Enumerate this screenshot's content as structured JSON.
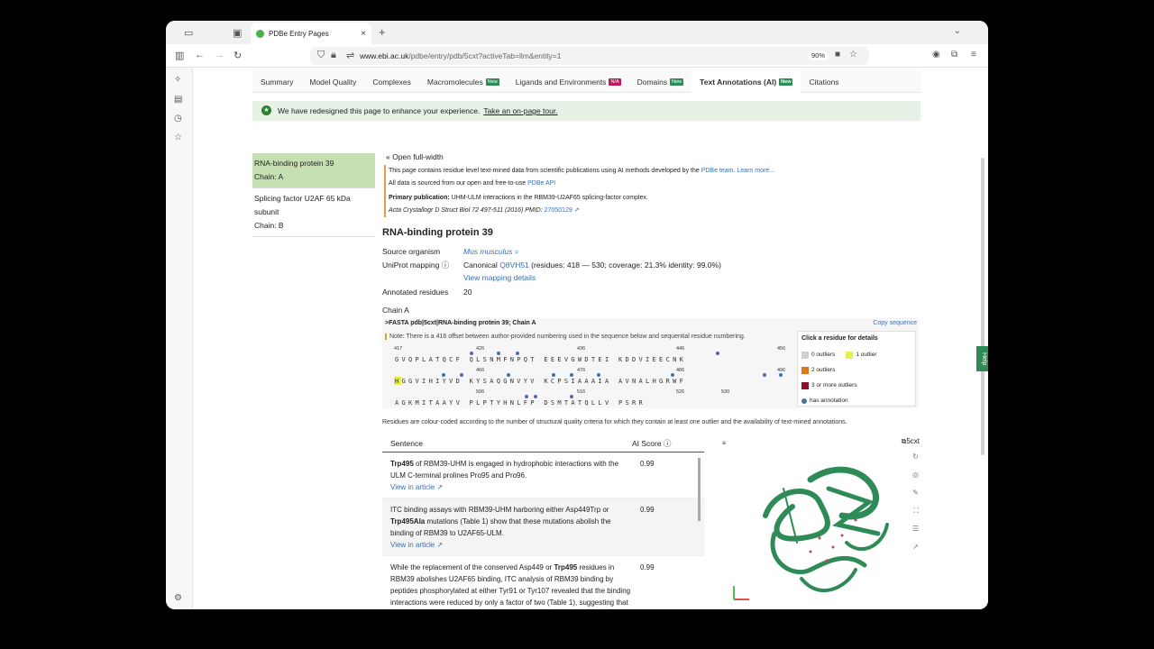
{
  "browser": {
    "tab_title": "PDBe Entry Pages",
    "url_host": "www.ebi.ac.uk",
    "url_path": "/pdbe/entry/pdb/5cxt?activeTab=llm&entity=1",
    "zoom": "90%"
  },
  "nav_tabs": [
    {
      "label": "Summary",
      "badge": ""
    },
    {
      "label": "Model Quality",
      "badge": ""
    },
    {
      "label": "Complexes",
      "badge": ""
    },
    {
      "label": "Macromolecules",
      "badge": "New"
    },
    {
      "label": "Ligands and Environments",
      "badge": "N/A"
    },
    {
      "label": "Domains",
      "badge": "New"
    },
    {
      "label": "Text Annotations (AI)",
      "badge": "New"
    },
    {
      "label": "Citations",
      "badge": ""
    }
  ],
  "banner": {
    "text": "We have redesigned this page to enhance your experience.",
    "link": "Take an on-page tour."
  },
  "sidebar": {
    "item1_title": "RNA-binding protein 39",
    "item1_chain": "Chain: A",
    "item2_title": "Splicing factor U2AF 65 kDa",
    "item2_title2": "subunit",
    "item2_chain": "Chain: B"
  },
  "main": {
    "open_full_width": "Open full-width",
    "info_line1": "This page contains residue level text-mined data from scientific publications using AI methods developed by the",
    "info_link1": "PDBe team",
    "info_link2": "Learn more...",
    "info_line2": "All data is sourced from our open and free-to-use",
    "info_link3": "PDBe API",
    "primary_label": "Primary publication:",
    "primary_text": "UHM-ULM interactions in the RBM39-U2AF65 splicing-factor complex.",
    "journal": "Acta Crystallogr D Struct Biol 72 497-511 (2016) PMID:",
    "pmid": "27050129",
    "title": "RNA-binding protein 39",
    "source_label": "Source organism",
    "source_value": "Mus musculus",
    "uniprot_label": "UniProt mapping",
    "uniprot_prefix": "Canonical",
    "uniprot_id": "Q8VH51",
    "uniprot_rest": "(residues: 418 — 530; coverage: 21.3% identity: 99.0%)",
    "mapping_link": "View mapping details",
    "annotated_label": "Annotated residues",
    "annotated_value": "20",
    "chain_label": "Chain A"
  },
  "fasta": {
    "header": ">FASTA pdb|5cxt|RNA-binding protein 39; Chain A",
    "copy": "Copy sequence",
    "note": "Note: There is a 416 offset between author-provided numbering used in the sequence below and sequential residue numbering.",
    "line1": "GVQPLATQCF QLSNMFNPQT EEEVGWDTEI KDDVIEECNK",
    "line2": "HGGVIHIYVD KYSAQGNVYV KCPSIAAAIA AVNALHGRWF",
    "line3": "AGKMITAAYV PLPTYHNLFP DSMTATQLLV PSRR",
    "nums1": [
      "417",
      "426",
      "436",
      "446",
      "456"
    ],
    "nums2": [
      "466",
      "476",
      "486",
      "496"
    ],
    "nums3": [
      "506",
      "516",
      "526",
      "530"
    ]
  },
  "legend": {
    "title": "Click a residue for details",
    "o0": "0 outliers",
    "o1": "1 outlier",
    "o2": "2 outliers",
    "o3": "3 or more outliers",
    "ann": "has annotation",
    "colors": {
      "o0": "#d0d0d0",
      "o1": "#e6f04a",
      "o2": "#e0751c",
      "o3": "#8b1030",
      "ann": "#4a6fa5"
    }
  },
  "caption": "Residues are colour-coded according to the number of structural quality criteria for which they contain at least one outlier and the availability of text-mined annotations.",
  "sentences": {
    "col_sentence": "Sentence",
    "col_score": "AI Score",
    "rows": [
      {
        "bold": "Trp495",
        "text": " of RBM39-UHM is engaged in hydrophobic interactions with the ULM C-terminal prolines Pro95 and Pro96.",
        "link": "View in article",
        "score": "0.99"
      },
      {
        "pre": "ITC binding assays with RBM39-UHM harboring either Asp449Trp or ",
        "bold": "Trp495Ala",
        "text": " mutations (Table 1) show that these mutations abolish the binding of RBM39 to U2AF65-ULM.",
        "link": "View in article",
        "score": "0.99"
      },
      {
        "pre": "While the replacement of the conserved Asp449 or ",
        "bold": "Trp495",
        "text": " residues in RBM39 abolishes U2AF65 binding, ITC analysis of RBM39 binding by peptides phosphorylated at either Tyr91 or Tyr107 revealed that the binding interactions were reduced by only a factor of two (Table 1), suggesting that tyrosine phosphorylation",
        "link": "",
        "score": "0.99"
      }
    ]
  },
  "viewer": {
    "pdb_id": "5cxt"
  },
  "help": "Help"
}
